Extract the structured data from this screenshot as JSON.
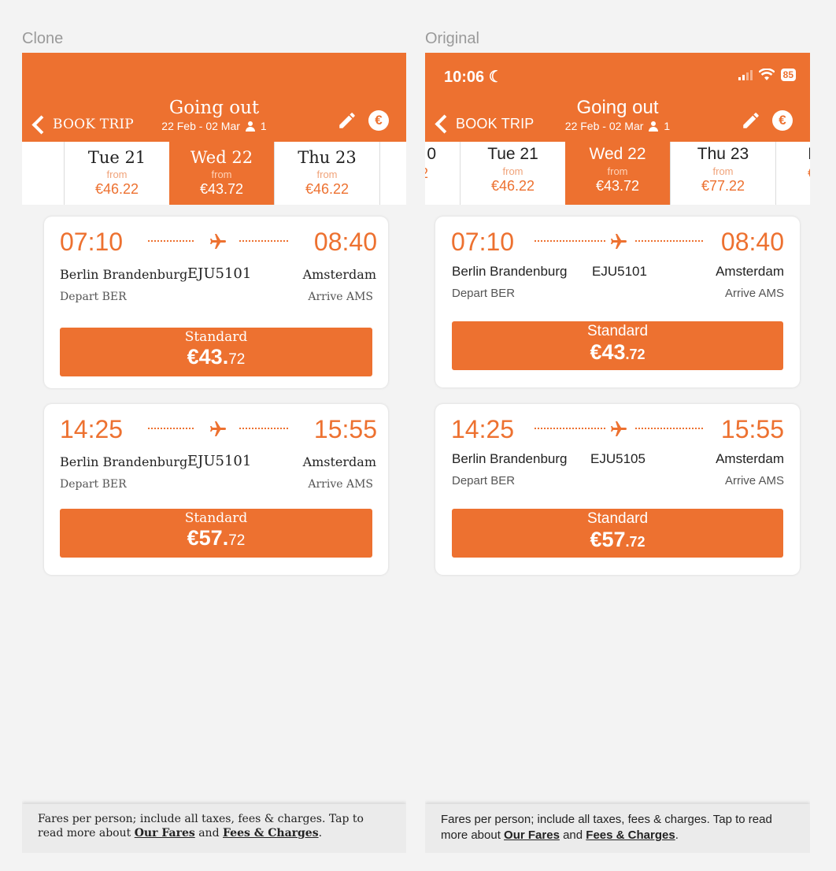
{
  "labels": {
    "clone": "Clone",
    "original": "Original"
  },
  "colors": {
    "accent": "#ed7130",
    "background": "#f3f3f3"
  },
  "clone": {
    "header": {
      "back_label": "BOOK TRIP",
      "title": "Going out",
      "dates": "22 Feb -  02 Mar",
      "passengers": "1",
      "edit_icon": "pencil-icon",
      "currency_icon": "euro-icon"
    },
    "date_strip": [
      {
        "day": "Tue 21",
        "from": "from",
        "price": "€46.22",
        "selected": false
      },
      {
        "day": "Wed 22",
        "from": "from",
        "price": "€43.72",
        "selected": true
      },
      {
        "day": "Thu 23",
        "from": "from",
        "price": "€46.22",
        "selected": false
      }
    ],
    "flights": [
      {
        "depart_time": "07:10",
        "arrive_time": "08:40",
        "origin": "Berlin Brandenburg",
        "destination": "Amsterdam",
        "flight_number": "EJU5101",
        "depart_label": "Depart BER",
        "arrive_label": "Arrive AMS",
        "fare_name": "Standard",
        "price_main": "€43.",
        "price_cents": "72"
      },
      {
        "depart_time": "14:25",
        "arrive_time": "15:55",
        "origin": "Berlin Brandenburg",
        "destination": "Amsterdam",
        "flight_number": "EJU5101",
        "depart_label": "Depart BER",
        "arrive_label": "Arrive AMS",
        "fare_name": "Standard",
        "price_main": "€57.",
        "price_cents": "72"
      }
    ],
    "footer": {
      "text_before": "Fares per person; include all taxes, fees & charges. Tap to read more about ",
      "link_fares": "Our Fares",
      "text_and": " and ",
      "link_fees": "Fees & Charges",
      "text_after": "."
    }
  },
  "original": {
    "status_bar": {
      "time": "10:06",
      "battery": "85",
      "moon_icon": "moon-icon",
      "wifi_icon": "wifi-icon"
    },
    "header": {
      "back_label": "BOOK TRIP",
      "title": "Going out",
      "dates": "22 Feb - 02 Mar",
      "passengers": "1",
      "edit_icon": "pencil-icon",
      "currency_icon": "euro-icon"
    },
    "date_strip": [
      {
        "day": "0",
        "from": "",
        "price": "2",
        "selected": false
      },
      {
        "day": "Tue 21",
        "from": "from",
        "price": "€46.22",
        "selected": false
      },
      {
        "day": "Wed 22",
        "from": "from",
        "price": "€43.72",
        "selected": true
      },
      {
        "day": "Thu 23",
        "from": "from",
        "price": "€77.22",
        "selected": false
      },
      {
        "day": "I",
        "from": "",
        "price": "€",
        "selected": false
      }
    ],
    "flights": [
      {
        "depart_time": "07:10",
        "arrive_time": "08:40",
        "origin": "Berlin Brandenburg",
        "destination": "Amsterdam",
        "flight_number": "EJU5101",
        "depart_label": "Depart BER",
        "arrive_label": "Arrive AMS",
        "fare_name": "Standard",
        "price_main": "€43",
        "price_cents": ".72"
      },
      {
        "depart_time": "14:25",
        "arrive_time": "15:55",
        "origin": "Berlin Brandenburg",
        "destination": "Amsterdam",
        "flight_number": "EJU5105",
        "depart_label": "Depart BER",
        "arrive_label": "Arrive AMS",
        "fare_name": "Standard",
        "price_main": "€57",
        "price_cents": ".72"
      }
    ],
    "footer": {
      "text_before": "Fares per person; include all taxes, fees & charges. Tap to read more about ",
      "link_fares": "Our Fares",
      "text_and": " and ",
      "link_fees": "Fees & Charges",
      "text_after": "."
    }
  }
}
